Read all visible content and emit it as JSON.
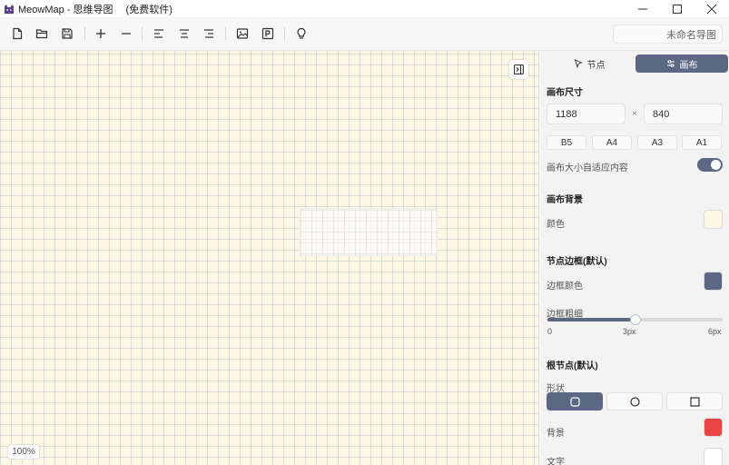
{
  "window": {
    "app_name": "MeowMap - 思维导图",
    "subtitle": "(免费软件)"
  },
  "toolbar": {
    "items": [
      {
        "name": "new-file-button",
        "icon": "file-icon"
      },
      {
        "name": "open-folder-button",
        "icon": "folder-icon"
      },
      {
        "name": "save-button",
        "icon": "save-icon"
      },
      {
        "name": "add-node-button",
        "icon": "plus-icon"
      },
      {
        "name": "remove-node-button",
        "icon": "minus-icon"
      },
      {
        "name": "align-left-button",
        "icon": "align-left-icon"
      },
      {
        "name": "align-center-button",
        "icon": "align-center-icon"
      },
      {
        "name": "align-right-button",
        "icon": "align-right-icon"
      },
      {
        "name": "export-image-button",
        "icon": "image-icon"
      },
      {
        "name": "export-pdf-button",
        "icon": "pdf-icon"
      },
      {
        "name": "tips-button",
        "icon": "lightbulb-icon"
      }
    ],
    "filename": "未命名导图"
  },
  "canvas": {
    "background_color": "#fdf8e5",
    "zoom": "100%"
  },
  "panel": {
    "tabs": [
      {
        "label": "节点",
        "icon": "cursor-icon"
      },
      {
        "label": "画布",
        "icon": "sliders-icon",
        "active": true
      }
    ],
    "canvas_size": {
      "title": "画布尺寸",
      "width": "1188",
      "height": "840",
      "times": "×",
      "presets": [
        "B5",
        "A4",
        "A3",
        "A1"
      ],
      "autofit_label": "画布大小自适应内容",
      "autofit_enabled": true
    },
    "background": {
      "title": "画布背景",
      "color_label": "颜色",
      "color": "#fdf8e5"
    },
    "node_border": {
      "title": "节点边框(默认)",
      "color_label": "边框颜色",
      "color": "#5c6783",
      "width_label": "边框粗细",
      "width_fraction": 0.5,
      "ticks": [
        "0",
        "3px",
        "6px"
      ]
    },
    "root_node": {
      "title": "根节点(默认)",
      "shape_label": "形状",
      "shapes": [
        {
          "name": "rounded",
          "icon": "rounded-square-icon",
          "active": true
        },
        {
          "name": "circle",
          "icon": "circle-icon",
          "active": false
        },
        {
          "name": "square",
          "icon": "square-icon",
          "active": false
        }
      ],
      "background_label": "背景",
      "background_color": "#e84545",
      "text_label": "文字",
      "text_color": "#ffffff"
    }
  },
  "colors": {
    "accent": "#5c6783"
  }
}
